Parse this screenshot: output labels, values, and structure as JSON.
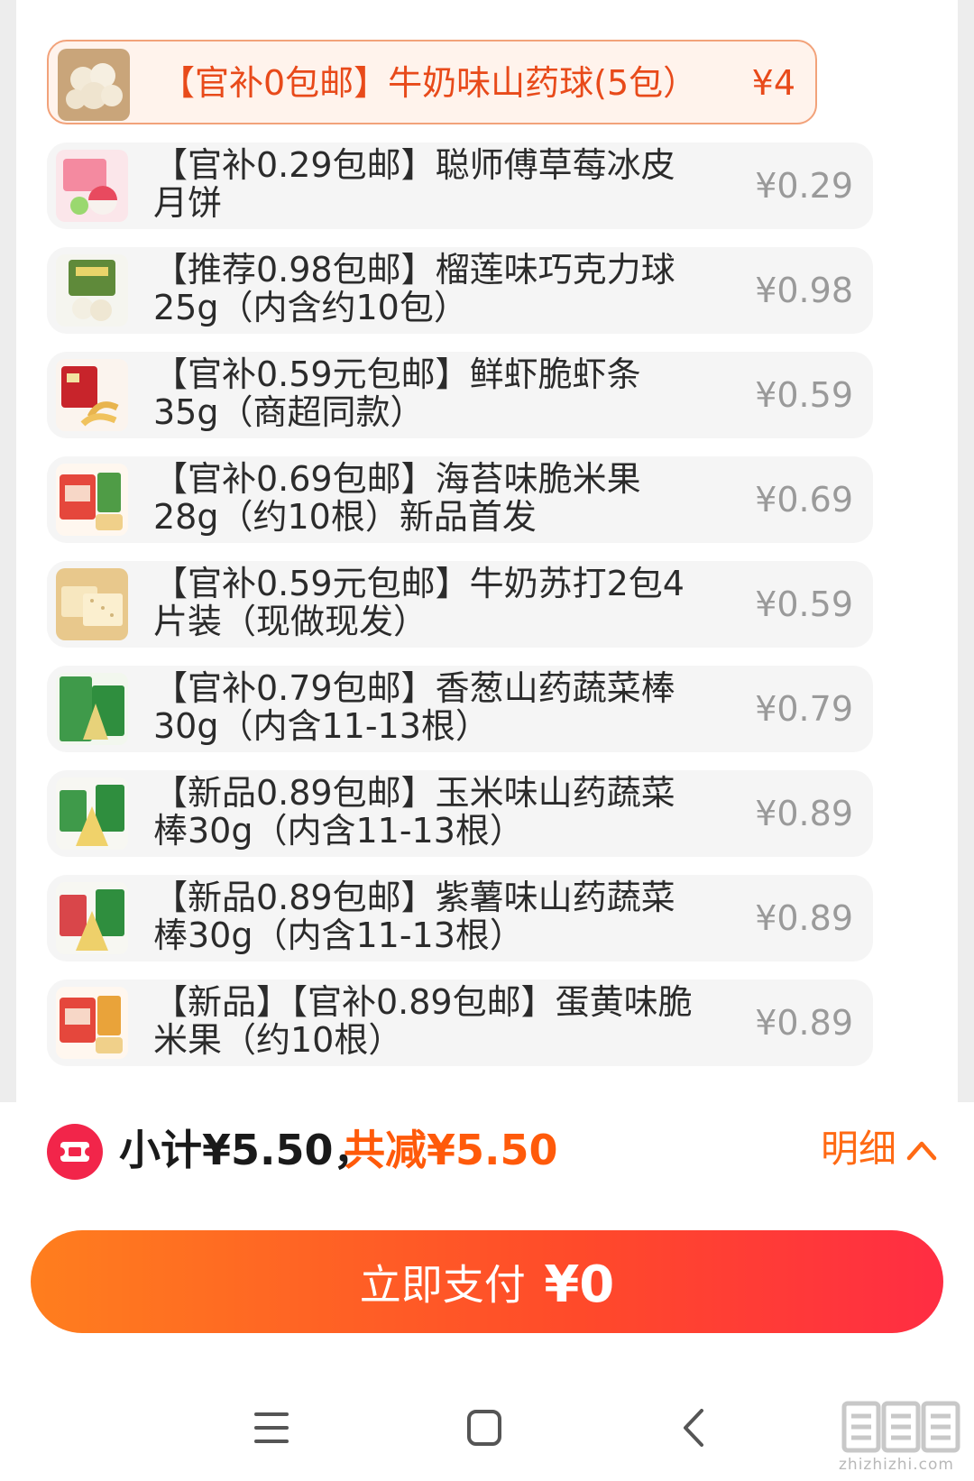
{
  "items": [
    {
      "name": "【官补0包邮】牛奶味山药球(5包）",
      "price": "¥4",
      "thumb": "milk-yam-ball-thumb",
      "selected": true
    },
    {
      "name": "【官补0.29包邮】聪师傅草莓冰皮月饼",
      "price": "¥0.29",
      "thumb": "strawberry-mooncake-thumb"
    },
    {
      "name": "【推荐0.98包邮】榴莲味巧克力球25g（内含约10包）",
      "price": "¥0.98",
      "thumb": "durian-choco-ball-thumb"
    },
    {
      "name": "【官补0.59元包邮】鲜虾脆虾条35g（商超同款）",
      "price": "¥0.59",
      "thumb": "shrimp-chips-thumb"
    },
    {
      "name": "【官补0.69包邮】海苔味脆米果28g（约10根）新品首发",
      "price": "¥0.69",
      "thumb": "seaweed-rice-cracker-thumb"
    },
    {
      "name": "【官补0.59元包邮】牛奶苏打2包4片装（现做现发）",
      "price": "¥0.59",
      "thumb": "milk-soda-cracker-thumb"
    },
    {
      "name": "【官补0.79包邮】香葱山药蔬菜棒30g（内含11-13根）",
      "price": "¥0.79",
      "thumb": "scallion-yam-stick-thumb"
    },
    {
      "name": "【新品0.89包邮】玉米味山药蔬菜棒30g（内含11-13根）",
      "price": "¥0.89",
      "thumb": "corn-yam-stick-thumb"
    },
    {
      "name": "【新品0.89包邮】紫薯味山药蔬菜棒30g（内含11-13根）",
      "price": "¥0.89",
      "thumb": "purple-potato-yam-stick-thumb"
    },
    {
      "name": "【新品】【官补0.89包邮】蛋黄味脆米果（约10根）",
      "price": "¥0.89",
      "thumb": "egg-yolk-rice-cracker-thumb"
    }
  ],
  "summary": {
    "subtotal": "小计¥5.50，",
    "discount": "共减¥5.50",
    "detail_label": "明细"
  },
  "pay": {
    "label": "立即支付",
    "amount": "¥0"
  },
  "watermark": {
    "site": "zhizhizhi.com"
  },
  "colors": {
    "accent": "#ff5a0a",
    "selected_text": "#e84a1a",
    "price_grey": "#9a9a9a"
  }
}
